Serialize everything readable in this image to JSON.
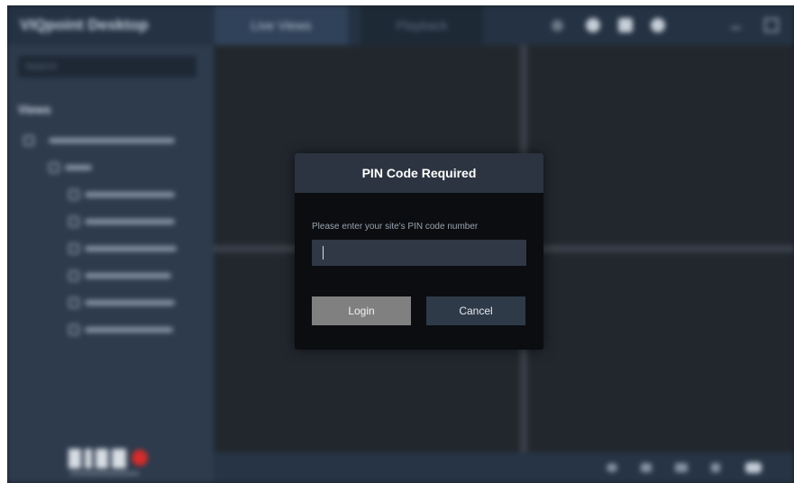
{
  "background_app": {
    "title": "VIQpoint Desktop",
    "tabs": [
      {
        "label": "Live Views",
        "active": true
      },
      {
        "label": "Playback",
        "active": false
      }
    ],
    "sidebar": {
      "search_placeholder": "Search",
      "heading": "Views"
    }
  },
  "dialog": {
    "title": "PIN Code Required",
    "prompt": "Please enter your site's PIN code number",
    "pin_value": "",
    "login_label": "Login",
    "cancel_label": "Cancel"
  },
  "colors": {
    "dialog_background": "#0b0d10",
    "dialog_header": "#2b3440",
    "login_button": "#808080",
    "cancel_button": "#2f3a48",
    "brand_red": "#d62b2b"
  }
}
